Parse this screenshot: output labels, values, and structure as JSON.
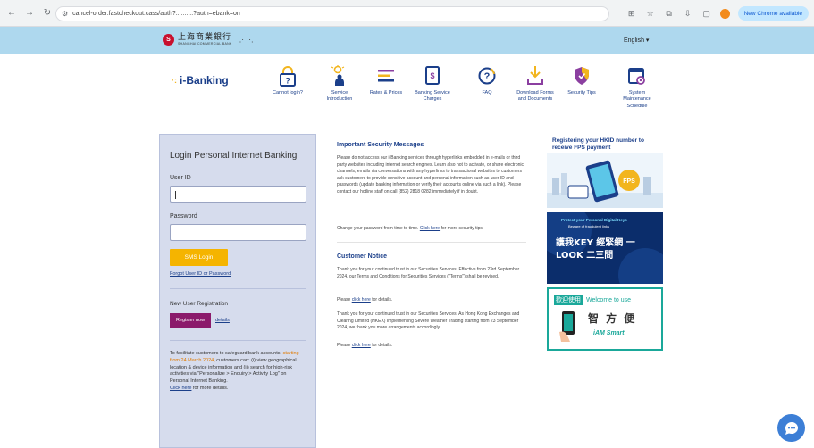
{
  "browser": {
    "url": "cancel-order.fastcheckout.cass/auth?..........?auth=ebank=on",
    "update_label": "New Chrome available"
  },
  "bank": {
    "name_cn": "上海商業銀行",
    "name_en": "SHANGHAI COMMERCIAL BANK",
    "language": "English ▾"
  },
  "ibanking": {
    "logo_text": "i-Banking"
  },
  "nav": [
    {
      "label": "Cannot login?"
    },
    {
      "label": "Service Introduction"
    },
    {
      "label": "Rates & Prices"
    },
    {
      "label": "Banking Service Charges"
    },
    {
      "label": "FAQ"
    },
    {
      "label": "Download Forms and Documents"
    },
    {
      "label": "Security Tips"
    },
    {
      "label": "System Maintenance Schedule"
    }
  ],
  "login": {
    "title": "Login Personal Internet Banking",
    "user_id_label": "User ID",
    "password_label": "Password",
    "login_button": "SMS Login",
    "forgot_link": "Forgot User ID or Password",
    "new_user_label": "New User Registration",
    "register_button": "Register now",
    "details_link": "details",
    "notice_prefix": "To facilitate customers to safeguard bank accounts,",
    "notice_highlight": "starting from 24 March 2024,",
    "notice_body": "customers can: (i) view geographical location & device information and (ii) search for high-risk activities via \"Personalize > Enquiry > Activity Log\" on Personal Internet Banking.",
    "notice_link": "Click here",
    "notice_suffix": "for more details."
  },
  "messages": {
    "security_title": "Important Security Messages",
    "security_body": "Please do not access our i-Banking services through hyperlinks embedded in e-mails or third party websites including internet search engines. Learn also not to activate, or share electronic channels, emails via conversations with any hyperlinks to transactional websites to customers ask customers to provide sensitive account and personal information such as user ID and passwords (update banking information or verify their accounts online via such a link). Please contact our hotline staff on call (852) 2818 0282 immediately if in doubt.",
    "security_change": "Change your password from time to time.",
    "security_change_link": "Click here",
    "security_change_suffix": "for more security tips.",
    "notice_title": "Customer Notice",
    "notice_body1": "Thank you for your continued trust in our Securities Services. Effective from 23rd September 2024, our Terms and Conditions for Securities Services (\"Terms\") shall be revised.",
    "notice_link1": "click here",
    "notice_link1_prefix": "Please",
    "notice_link1_suffix": "for details.",
    "notice_body2": "Thank you for your continued trust in our Securities Services. As Hong Kong Exchanges and Clearing Limited (HKEX) Implementing Severe Weather Trading starting from 23 September 2024, we thank you more arrangements accordingly.",
    "notice_link2": "click here",
    "notice_link2_prefix": "Please",
    "notice_link2_suffix": "for details."
  },
  "banners": {
    "b1_title": "Registering your HKID number to receive FPS payment",
    "b2_title": "Protect your Personal Digital Keys",
    "b2_sub": "Beware of fraudulent links",
    "b2_cn": "護我KEY 經緊網 一LOOK 二三問",
    "b3_cn_welcome": "歡迎使用",
    "b3_en_welcome": "Welcome to use",
    "b3_cn_app": "智 方 便",
    "b3_en_app": "iAM Smart"
  },
  "colors": {
    "header_blue": "#aed8ee",
    "panel_bg": "#d6dced",
    "accent_yellow": "#f5b400",
    "register_purple": "#8b1a6b",
    "link_blue": "#1b3f8a"
  }
}
